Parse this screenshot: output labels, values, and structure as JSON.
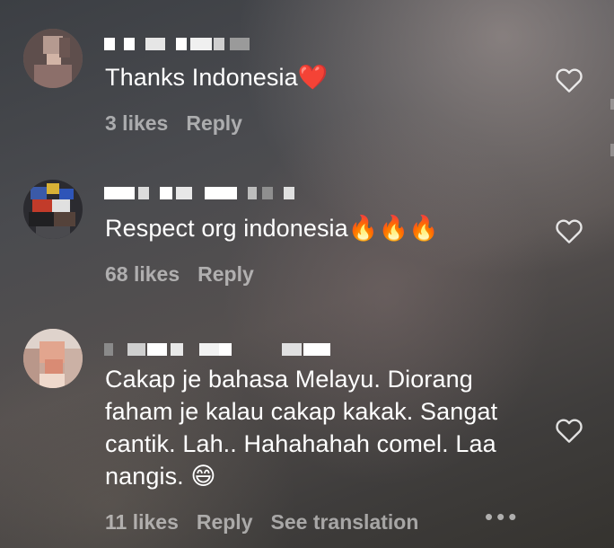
{
  "comments": [
    {
      "text": "Thanks Indonesia❤️",
      "likes": "3 likes",
      "reply": "Reply"
    },
    {
      "text": "Respect org indonesia🔥🔥🔥",
      "likes": "68 likes",
      "reply": "Reply"
    },
    {
      "text": "Cakap je bahasa Melayu. Diorang faham je kalau cakap kakak. Sangat cantik. Lah.. Hahahahah comel. Laa nangis. 😄",
      "likes": "11 likes",
      "reply": "Reply",
      "translate": "See translation"
    }
  ],
  "icons": {
    "like": "heart-outline-icon",
    "more": "more-options-icon"
  },
  "colors": {
    "text": "#ffffff",
    "meta": "rgba(255,255,255,0.55)"
  }
}
